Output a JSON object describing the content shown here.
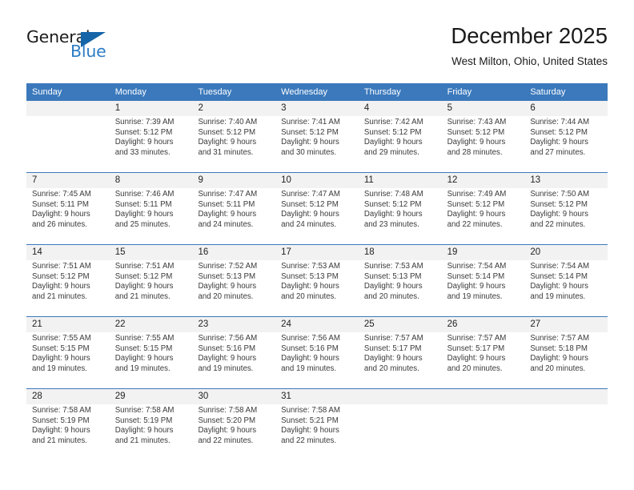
{
  "brand": {
    "name_top": "General",
    "name_bottom": "Blue",
    "accent_color": "#2e7cc4",
    "triangle_color": "#1565a8"
  },
  "header": {
    "title": "December 2025",
    "subtitle": "West Milton, Ohio, United States"
  },
  "theme": {
    "header_blue": "#3b79bc",
    "daynum_band": "#f2f2f2",
    "text": "#3a3a3a"
  },
  "calendar": {
    "weekday_headers": [
      "Sunday",
      "Monday",
      "Tuesday",
      "Wednesday",
      "Thursday",
      "Friday",
      "Saturday"
    ],
    "weeks": [
      [
        {
          "day": "",
          "lines": []
        },
        {
          "day": "1",
          "lines": [
            "Sunrise: 7:39 AM",
            "Sunset: 5:12 PM",
            "Daylight: 9 hours",
            "and 33 minutes."
          ]
        },
        {
          "day": "2",
          "lines": [
            "Sunrise: 7:40 AM",
            "Sunset: 5:12 PM",
            "Daylight: 9 hours",
            "and 31 minutes."
          ]
        },
        {
          "day": "3",
          "lines": [
            "Sunrise: 7:41 AM",
            "Sunset: 5:12 PM",
            "Daylight: 9 hours",
            "and 30 minutes."
          ]
        },
        {
          "day": "4",
          "lines": [
            "Sunrise: 7:42 AM",
            "Sunset: 5:12 PM",
            "Daylight: 9 hours",
            "and 29 minutes."
          ]
        },
        {
          "day": "5",
          "lines": [
            "Sunrise: 7:43 AM",
            "Sunset: 5:12 PM",
            "Daylight: 9 hours",
            "and 28 minutes."
          ]
        },
        {
          "day": "6",
          "lines": [
            "Sunrise: 7:44 AM",
            "Sunset: 5:12 PM",
            "Daylight: 9 hours",
            "and 27 minutes."
          ]
        }
      ],
      [
        {
          "day": "7",
          "lines": [
            "Sunrise: 7:45 AM",
            "Sunset: 5:11 PM",
            "Daylight: 9 hours",
            "and 26 minutes."
          ]
        },
        {
          "day": "8",
          "lines": [
            "Sunrise: 7:46 AM",
            "Sunset: 5:11 PM",
            "Daylight: 9 hours",
            "and 25 minutes."
          ]
        },
        {
          "day": "9",
          "lines": [
            "Sunrise: 7:47 AM",
            "Sunset: 5:11 PM",
            "Daylight: 9 hours",
            "and 24 minutes."
          ]
        },
        {
          "day": "10",
          "lines": [
            "Sunrise: 7:47 AM",
            "Sunset: 5:12 PM",
            "Daylight: 9 hours",
            "and 24 minutes."
          ]
        },
        {
          "day": "11",
          "lines": [
            "Sunrise: 7:48 AM",
            "Sunset: 5:12 PM",
            "Daylight: 9 hours",
            "and 23 minutes."
          ]
        },
        {
          "day": "12",
          "lines": [
            "Sunrise: 7:49 AM",
            "Sunset: 5:12 PM",
            "Daylight: 9 hours",
            "and 22 minutes."
          ]
        },
        {
          "day": "13",
          "lines": [
            "Sunrise: 7:50 AM",
            "Sunset: 5:12 PM",
            "Daylight: 9 hours",
            "and 22 minutes."
          ]
        }
      ],
      [
        {
          "day": "14",
          "lines": [
            "Sunrise: 7:51 AM",
            "Sunset: 5:12 PM",
            "Daylight: 9 hours",
            "and 21 minutes."
          ]
        },
        {
          "day": "15",
          "lines": [
            "Sunrise: 7:51 AM",
            "Sunset: 5:12 PM",
            "Daylight: 9 hours",
            "and 21 minutes."
          ]
        },
        {
          "day": "16",
          "lines": [
            "Sunrise: 7:52 AM",
            "Sunset: 5:13 PM",
            "Daylight: 9 hours",
            "and 20 minutes."
          ]
        },
        {
          "day": "17",
          "lines": [
            "Sunrise: 7:53 AM",
            "Sunset: 5:13 PM",
            "Daylight: 9 hours",
            "and 20 minutes."
          ]
        },
        {
          "day": "18",
          "lines": [
            "Sunrise: 7:53 AM",
            "Sunset: 5:13 PM",
            "Daylight: 9 hours",
            "and 20 minutes."
          ]
        },
        {
          "day": "19",
          "lines": [
            "Sunrise: 7:54 AM",
            "Sunset: 5:14 PM",
            "Daylight: 9 hours",
            "and 19 minutes."
          ]
        },
        {
          "day": "20",
          "lines": [
            "Sunrise: 7:54 AM",
            "Sunset: 5:14 PM",
            "Daylight: 9 hours",
            "and 19 minutes."
          ]
        }
      ],
      [
        {
          "day": "21",
          "lines": [
            "Sunrise: 7:55 AM",
            "Sunset: 5:15 PM",
            "Daylight: 9 hours",
            "and 19 minutes."
          ]
        },
        {
          "day": "22",
          "lines": [
            "Sunrise: 7:55 AM",
            "Sunset: 5:15 PM",
            "Daylight: 9 hours",
            "and 19 minutes."
          ]
        },
        {
          "day": "23",
          "lines": [
            "Sunrise: 7:56 AM",
            "Sunset: 5:16 PM",
            "Daylight: 9 hours",
            "and 19 minutes."
          ]
        },
        {
          "day": "24",
          "lines": [
            "Sunrise: 7:56 AM",
            "Sunset: 5:16 PM",
            "Daylight: 9 hours",
            "and 19 minutes."
          ]
        },
        {
          "day": "25",
          "lines": [
            "Sunrise: 7:57 AM",
            "Sunset: 5:17 PM",
            "Daylight: 9 hours",
            "and 20 minutes."
          ]
        },
        {
          "day": "26",
          "lines": [
            "Sunrise: 7:57 AM",
            "Sunset: 5:17 PM",
            "Daylight: 9 hours",
            "and 20 minutes."
          ]
        },
        {
          "day": "27",
          "lines": [
            "Sunrise: 7:57 AM",
            "Sunset: 5:18 PM",
            "Daylight: 9 hours",
            "and 20 minutes."
          ]
        }
      ],
      [
        {
          "day": "28",
          "lines": [
            "Sunrise: 7:58 AM",
            "Sunset: 5:19 PM",
            "Daylight: 9 hours",
            "and 21 minutes."
          ]
        },
        {
          "day": "29",
          "lines": [
            "Sunrise: 7:58 AM",
            "Sunset: 5:19 PM",
            "Daylight: 9 hours",
            "and 21 minutes."
          ]
        },
        {
          "day": "30",
          "lines": [
            "Sunrise: 7:58 AM",
            "Sunset: 5:20 PM",
            "Daylight: 9 hours",
            "and 22 minutes."
          ]
        },
        {
          "day": "31",
          "lines": [
            "Sunrise: 7:58 AM",
            "Sunset: 5:21 PM",
            "Daylight: 9 hours",
            "and 22 minutes."
          ]
        },
        {
          "day": "",
          "lines": []
        },
        {
          "day": "",
          "lines": []
        },
        {
          "day": "",
          "lines": []
        }
      ]
    ]
  }
}
